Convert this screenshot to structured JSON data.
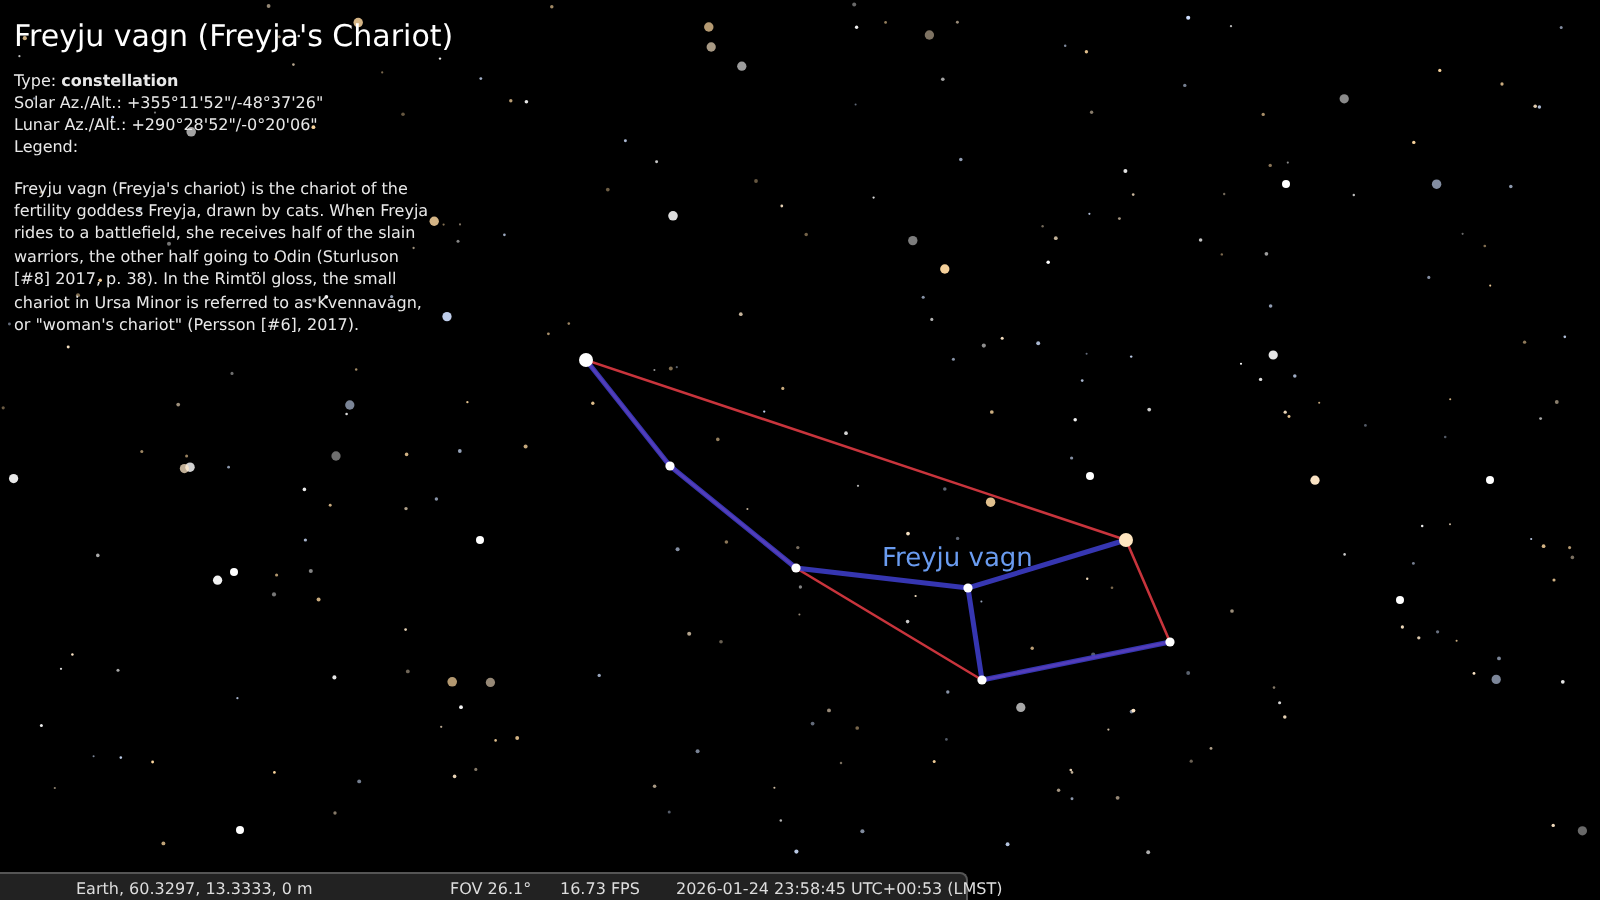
{
  "info_panel": {
    "title": "Freyju vagn (Freyja's Chariot)",
    "lines": [
      "Type: **constellation**",
      "Solar Az./Alt.: +355°11'52\"/-48°37'26\"",
      "Lunar Az./Alt.: +290°28'52\"/-0°20'06\"",
      "Legend:"
    ],
    "description": "Freyju vagn (Freyja's chariot) is the chariot of the fertility goddess Freyja, drawn by cats. When Freyja rides to a battlefield, she receives half of the slain warriors, the other half going to Odin (Sturluson [#8] 2017, p. 38). In the Rimtöl gloss, the small chariot in Ursa Minor is referred to as Kvennavagn, or \"woman's chariot\" (Persson [#6], 2017)."
  },
  "constellation_label": "Freyju vagn",
  "status_bar": {
    "location": "Earth, 60.3297, 13.3333, 0 m",
    "fov": "FOV 26.1°",
    "fps": "16.73 FPS",
    "datetime": "2026-01-24 23:58:45 UTC+00:53 (LMST)"
  }
}
